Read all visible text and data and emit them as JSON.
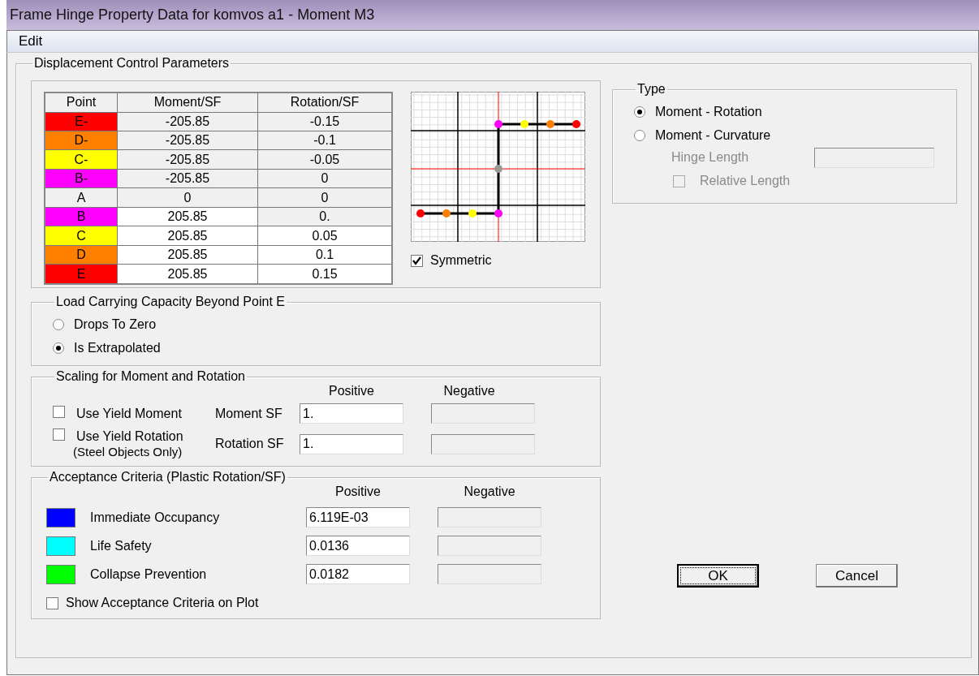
{
  "window": {
    "title": "Frame Hinge Property Data for komvos a1 - Moment M3"
  },
  "menu": [
    "Edit"
  ],
  "displacement": {
    "title": "Displacement Control Parameters",
    "table": {
      "columns": [
        "Point",
        "Moment/SF",
        "Rotation/SF"
      ],
      "rows": [
        {
          "point": "E-",
          "color": "#ff0000",
          "moment": "-205.85",
          "rotation": "-0.15",
          "moment_locked": true,
          "rotation_locked": true
        },
        {
          "point": "D-",
          "color": "#ff8000",
          "moment": "-205.85",
          "rotation": "-0.1",
          "moment_locked": true,
          "rotation_locked": true
        },
        {
          "point": "C-",
          "color": "#ffff00",
          "moment": "-205.85",
          "rotation": "-0.05",
          "moment_locked": true,
          "rotation_locked": true
        },
        {
          "point": "B-",
          "color": "#ff00ff",
          "moment": "-205.85",
          "rotation": "0",
          "moment_locked": true,
          "rotation_locked": true
        },
        {
          "point": "A",
          "color": "#f0f0f0",
          "moment": "0",
          "rotation": "0",
          "moment_locked": true,
          "rotation_locked": true
        },
        {
          "point": "B",
          "color": "#ff00ff",
          "moment": "205.85",
          "rotation": "0.",
          "moment_locked": false,
          "rotation_locked": true
        },
        {
          "point": "C",
          "color": "#ffff00",
          "moment": "205.85",
          "rotation": "0.05",
          "moment_locked": false,
          "rotation_locked": false
        },
        {
          "point": "D",
          "color": "#ff8000",
          "moment": "205.85",
          "rotation": "0.1",
          "moment_locked": false,
          "rotation_locked": false
        },
        {
          "point": "E",
          "color": "#ff0000",
          "moment": "205.85",
          "rotation": "0.15",
          "moment_locked": false,
          "rotation_locked": false
        }
      ]
    },
    "symmetric": {
      "label": "Symmetric",
      "checked": true
    }
  },
  "load_capacity": {
    "title": "Load Carrying Capacity Beyond Point E",
    "options": [
      {
        "label": "Drops To Zero",
        "selected": false
      },
      {
        "label": "Is Extrapolated",
        "selected": true
      }
    ]
  },
  "scaling": {
    "title": "Scaling for Moment and Rotation",
    "positive_header": "Positive",
    "negative_header": "Negative",
    "rows": [
      {
        "check_label": "Use Yield Moment",
        "checked": false,
        "field_label": "Moment SF",
        "positive": "1.",
        "negative_disabled": true
      },
      {
        "check_label": "Use Yield Rotation",
        "check_note": "(Steel Objects Only)",
        "checked": false,
        "field_label": "Rotation SF",
        "positive": "1.",
        "negative_disabled": true
      }
    ]
  },
  "acceptance": {
    "title": "Acceptance Criteria (Plastic Rotation/SF)",
    "positive_header": "Positive",
    "negative_header": "Negative",
    "rows": [
      {
        "label": "Immediate Occupancy",
        "color": "#0000ff",
        "positive": "6.119E-03",
        "negative_disabled": true
      },
      {
        "label": "Life Safety",
        "color": "#00ffff",
        "positive": "0.0136",
        "negative_disabled": true
      },
      {
        "label": "Collapse Prevention",
        "color": "#00ff00",
        "positive": "0.0182",
        "negative_disabled": true
      }
    ],
    "show_on_plot": {
      "label": "Show Acceptance Criteria on Plot",
      "checked": false
    }
  },
  "type": {
    "title": "Type",
    "options": [
      {
        "label": "Moment - Rotation",
        "selected": true
      },
      {
        "label": "Moment - Curvature",
        "selected": false
      }
    ],
    "hinge_length": {
      "label": "Hinge Length",
      "disabled": true
    },
    "relative_length": {
      "label": "Relative Length",
      "checked": false,
      "disabled": true
    }
  },
  "buttons": [
    {
      "label": "OK",
      "focused": true
    },
    {
      "label": "Cancel",
      "focused": false
    }
  ]
}
